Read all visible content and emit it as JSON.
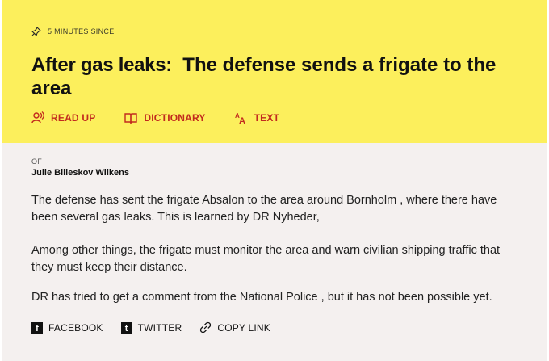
{
  "article": {
    "timestamp": "5 MINUTES SINCE",
    "headline_kicker": "After gas leaks:",
    "headline_text": "The defense sends a frigate to the area"
  },
  "toolbar": {
    "read_up": "READ UP",
    "dictionary": "DICTIONARY",
    "text": "TEXT",
    "accent_color": "#c22a1e"
  },
  "byline": {
    "of_label": "OF",
    "author": "Julie Billeskov Wilkens"
  },
  "paragraphs": [
    "The defense has sent the frigate Absalon to the area around Bornholm , where there have been several gas leaks. This is learned by DR Nyheder,",
    "Among other things, the frigate must monitor the area and warn civilian shipping traffic that they must keep their distance.",
    "DR has tried to get a comment from the National Police , but it has not been possible yet."
  ],
  "share": {
    "facebook": "FACEBOOK",
    "twitter": "TWITTER",
    "copy_link": "COPY LINK"
  },
  "colors": {
    "hero_background": "#fcef5c",
    "body_background": "#f4f0ef"
  },
  "icons": [
    "pin-icon",
    "speaker-icon",
    "book-icon",
    "text-size-icon",
    "facebook-icon",
    "twitter-icon",
    "link-icon"
  ]
}
